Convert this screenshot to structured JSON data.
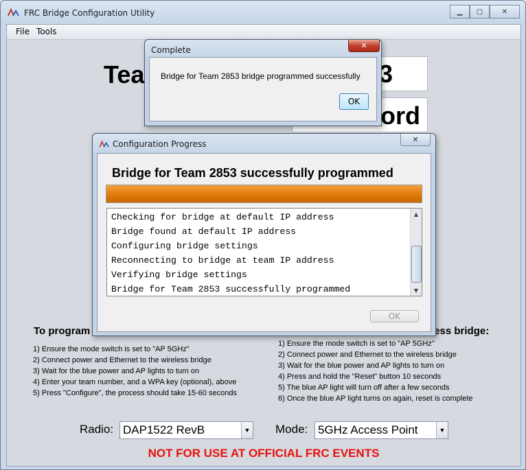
{
  "window": {
    "title": "FRC Bridge Configuration Utility"
  },
  "menu": {
    "items": [
      "File",
      "Tools"
    ]
  },
  "main": {
    "team_label_fragment": "Tea",
    "team_value_fragment": "3",
    "password_fragment": "ord",
    "left_heading": "To program",
    "right_heading": "less bridge:",
    "left_steps": [
      "1) Ensure the mode switch is set to \"AP 5GHz\"",
      "2) Connect power and Ethernet to the wireless bridge",
      "3) Wait for the blue power and AP lights to turn on",
      "4) Enter your team number, and a WPA key (optional), above",
      "5) Press \"Configure\", the process should take 15-60 seconds"
    ],
    "right_steps": [
      "1) Ensure the mode switch is set to \"AP 5GHz\"",
      "2) Connect power and Ethernet to the wireless bridge",
      "3) Wait for the blue power and AP lights to turn on",
      "4) Press and hold the \"Reset\" button 10 seconds",
      "5) The blue AP light will turn off after a few seconds",
      "6) Once the blue AP light turns on again, reset is complete"
    ],
    "radio_label": "Radio:",
    "radio_value": "DAP1522 RevB",
    "mode_label": "Mode:",
    "mode_value": "5GHz Access Point",
    "warning": "NOT FOR USE AT OFFICIAL FRC EVENTS"
  },
  "progress_dialog": {
    "title": "Configuration Progress",
    "heading": "Bridge for Team 2853 successfully programmed",
    "progress": 1.0,
    "log": [
      "Checking for bridge at default IP address",
      "Bridge found at default IP address",
      "Configuring bridge settings",
      "Reconnecting to bridge at team IP address",
      "Verifying bridge settings",
      "Bridge for Team 2853 successfully programmed"
    ],
    "ok_label": "OK"
  },
  "complete_dialog": {
    "title": "Complete",
    "message": "Bridge for Team 2853 bridge programmed successfully",
    "ok_label": "OK"
  },
  "colors": {
    "warning": "#e8110d",
    "progress": "#e07a0b"
  },
  "icons": {
    "app": "frc-logo-icon",
    "close": "close-icon",
    "minimize": "minimize-icon",
    "maximize": "maximize-icon"
  }
}
